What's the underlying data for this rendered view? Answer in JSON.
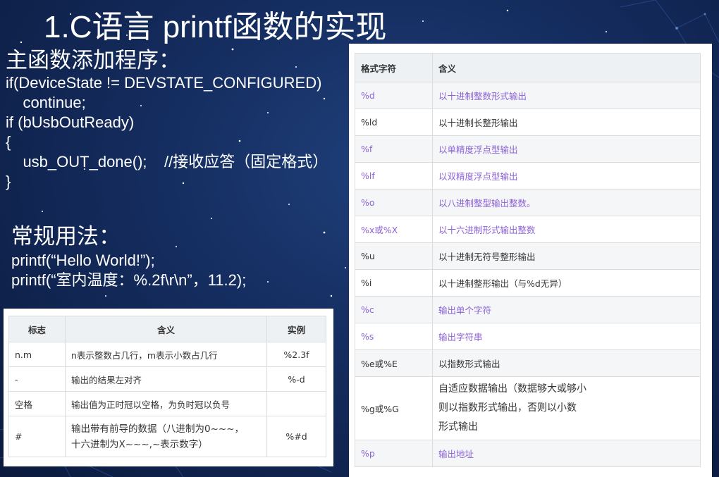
{
  "slide": {
    "title": "1.C语言 printf函数的实现"
  },
  "main_code": {
    "heading": "主函数添加程序：",
    "lines": [
      "if(DeviceState != DEVSTATE_CONFIGURED)",
      "    continue;",
      "if (bUsbOutReady)",
      "{",
      "    usb_OUT_done();    //接收应答（固定格式）",
      "}"
    ]
  },
  "usage": {
    "heading": "常规用法：",
    "lines": [
      "printf(“Hello World!”);",
      "printf(“室内温度：%.2f\\r\\n”，11.2);"
    ]
  },
  "flags_table": {
    "headers": [
      "标志",
      "含义",
      "实例"
    ],
    "rows": [
      {
        "flag": "n.m",
        "meaning": "n表示整数占几行，m表示小数占几行",
        "example": "%2.3f"
      },
      {
        "flag": "-",
        "meaning": "输出的结果左对齐",
        "example": "%-d"
      },
      {
        "flag": "空格",
        "meaning": "输出值为正时冠以空格，为负时冠以负号",
        "example": ""
      },
      {
        "flag": "#",
        "meaning": "输出带有前导的数据（八进制为0~~~，",
        "meaning2": "十六进制为X~~~,~表示数字）",
        "example": "%#d"
      }
    ]
  },
  "format_table": {
    "headers": [
      "格式字符",
      "含义"
    ],
    "rows": [
      {
        "code": "%d",
        "meaning": "以十进制整数形式输出",
        "purple": true
      },
      {
        "code": "%ld",
        "meaning": "以十进制长整形输出",
        "purple": false
      },
      {
        "code": "%f",
        "meaning": "以单精度浮点型输出",
        "purple": true
      },
      {
        "code": "%lf",
        "meaning": "以双精度浮点型输出",
        "purple": true
      },
      {
        "code": "%o",
        "meaning": "以八进制整型输出整数。",
        "purple": true
      },
      {
        "code": "%x或%X",
        "meaning": "以十六进制形式输出整数",
        "purple": true
      },
      {
        "code": "%u",
        "meaning": "以十进制无符号整形输出",
        "purple": false
      },
      {
        "code": "%i",
        "meaning": "以十进制整形输出（与%d无异）",
        "purple": false
      },
      {
        "code": "%c",
        "meaning": "输出单个字符",
        "purple": true
      },
      {
        "code": "%s",
        "meaning": "输出字符串",
        "purple": true
      },
      {
        "code": "%e或%E",
        "meaning": "以指数形式输出",
        "purple": false
      },
      {
        "code": "%g或%G",
        "meaning_lines": [
          "自适应数据输出（数据够大或够小",
          "则以指数形式输出，否则以小数",
          "形式输出"
        ],
        "purple": false
      },
      {
        "code": "%p",
        "meaning": "输出地址",
        "purple": true
      }
    ]
  }
}
